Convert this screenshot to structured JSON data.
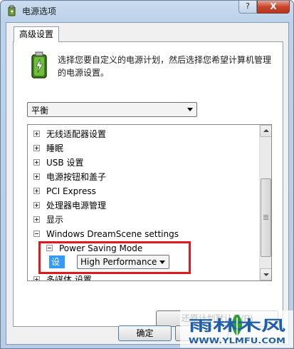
{
  "window": {
    "title": "电源选项",
    "help_label": "?",
    "close_label": "X"
  },
  "tab": {
    "label": "高级设置"
  },
  "description": "选择您要自定义的电源计划，然后选择您希望计算机管理的电源设置。",
  "plan": {
    "selected": "平衡"
  },
  "tree": {
    "items": [
      {
        "label": "无线适配器设置",
        "state": "plus"
      },
      {
        "label": "睡眠",
        "state": "plus"
      },
      {
        "label": "USB 设置",
        "state": "plus"
      },
      {
        "label": "电源按钮和盖子",
        "state": "plus"
      },
      {
        "label": "PCI Express",
        "state": "plus"
      },
      {
        "label": "处理器电源管理",
        "state": "plus"
      },
      {
        "label": "显示",
        "state": "plus"
      },
      {
        "label": "Windows DreamScene settings",
        "state": "minus"
      }
    ],
    "child": {
      "label": "Power Saving Mode",
      "state": "minus"
    },
    "setting": {
      "label": "设置:",
      "value": "High Performance"
    },
    "partial_item": "多媒体 设置"
  },
  "buttons": {
    "restore": "还原计划默认值(R)",
    "ok": "确定"
  },
  "watermark": {
    "brand": "雨林木风",
    "url": "WWW.YLMFU.COM"
  },
  "colors": {
    "highlight": "#3399ff",
    "annotation": "#e0191f"
  }
}
